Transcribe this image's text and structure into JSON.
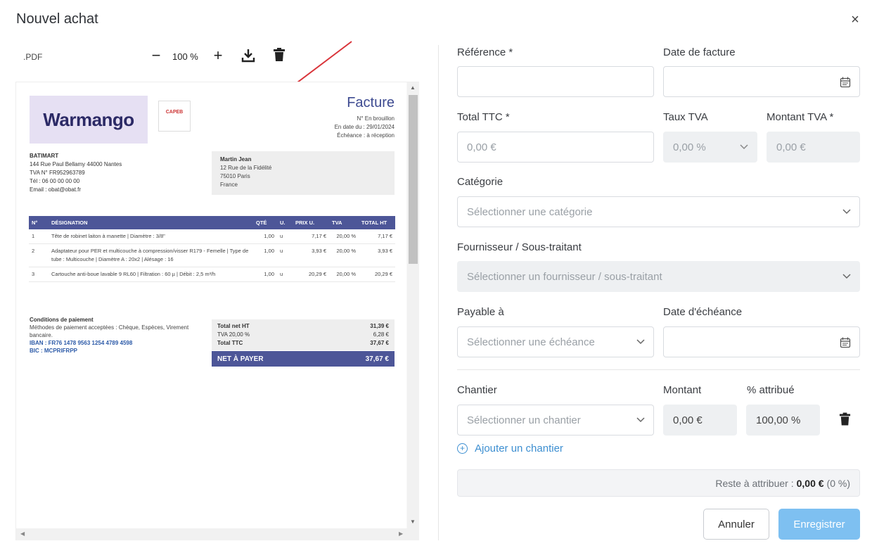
{
  "modal": {
    "title": "Nouvel achat"
  },
  "viewer": {
    "file_type": ".PDF",
    "zoom": "100 %",
    "zoom_out": "−",
    "zoom_in": "+"
  },
  "invoice": {
    "logo_text": "Warmango",
    "capeb": "CAPEB",
    "title": "Facture",
    "number": "N° En brouillon",
    "date": "En date du : 29/01/2024",
    "due": "Échéance : à réception",
    "sender": {
      "name": "BATIMART",
      "address": "144 Rue Paul Bellamy 44000 Nantes",
      "vat": "TVA N° FR952963789",
      "tel": "Tél : 06 00 00 00 00",
      "email": "Email : obat@obat.fr"
    },
    "client": {
      "name": "Martin Jean",
      "street": "12 Rue de la Fidélité",
      "city": "75010 Paris",
      "country": "France"
    },
    "headers": [
      "N°",
      "DÉSIGNATION",
      "QTÉ",
      "U.",
      "PRIX U.",
      "TVA",
      "TOTAL HT"
    ],
    "lines": [
      {
        "n": "1",
        "desc": "Tête de robinet laiton à manette | Diamètre : 3/8\"",
        "qty": "1,00",
        "u": "u",
        "pu": "7,17 €",
        "tva": "20,00 %",
        "total": "7,17 €"
      },
      {
        "n": "2",
        "desc": "Adaptateur pour PER et multicouche à compression/visser R179 - Femelle | Type de tube : Multicouche | Diamètre A : 20x2 | Alésage : 16",
        "qty": "1,00",
        "u": "u",
        "pu": "3,93 €",
        "tva": "20,00 %",
        "total": "3,93 €"
      },
      {
        "n": "3",
        "desc": "Cartouche anti-boue lavable 9 RL60 | Filtration : 60 µ | Débit : 2,5 m³/h",
        "qty": "1,00",
        "u": "u",
        "pu": "20,29 €",
        "tva": "20,00 %",
        "total": "20,29 €"
      }
    ],
    "conditions": {
      "title": "Conditions de paiement",
      "methods": "Méthodes de paiement acceptées : Chèque, Espèces, Virement bancaire.",
      "iban": "IBAN : FR76 1478 9563 1254 4789 4598",
      "bic": "BIC : MCPRIFRPP"
    },
    "totals": {
      "net_ht_label": "Total net HT",
      "net_ht": "31,39 €",
      "tva_label": "TVA 20,00 %",
      "tva": "6,28 €",
      "ttc_label": "Total TTC",
      "ttc": "37,67 €",
      "pay_label": "NET À PAYER",
      "pay": "37,67 €"
    }
  },
  "form": {
    "reference_label": "Référence *",
    "reference_value": "",
    "invoice_date_label": "Date de facture",
    "total_ttc_label": "Total TTC *",
    "total_ttc_placeholder": "0,00 €",
    "vat_rate_label": "Taux TVA",
    "vat_rate_value": "0,00 %",
    "vat_amount_label": "Montant TVA *",
    "vat_amount_value": "0,00 €",
    "category_label": "Catégorie",
    "category_placeholder": "Sélectionner une catégorie",
    "supplier_label": "Fournisseur / Sous-traitant",
    "supplier_placeholder": "Sélectionner un fournisseur / sous-traitant",
    "payable_label": "Payable à",
    "payable_placeholder": "Sélectionner une échéance",
    "due_date_label": "Date d'échéance",
    "site_label": "Chantier",
    "site_placeholder": "Sélectionner un chantier",
    "amount_label": "Montant",
    "amount_value": "0,00 €",
    "percent_label": "% attribué",
    "percent_value": "100,00 %",
    "add_site": "Ajouter un chantier",
    "remaining_label": "Reste à attribuer :",
    "remaining_value": "0,00 €",
    "remaining_pct": "(0 %)",
    "cancel": "Annuler",
    "save": "Enregistrer"
  }
}
